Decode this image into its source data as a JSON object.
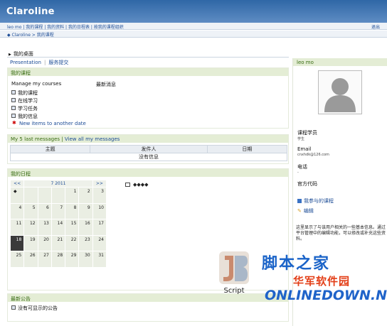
{
  "app": {
    "logo": "Claroline"
  },
  "topnav": {
    "links": "leo mo | 我的课程 | 我的资料 | 我的日程表 | 按我的课程组织",
    "right": "退出"
  },
  "breadcrumb": {
    "text": "◆ Claroline > 我的课程"
  },
  "page": {
    "title": "我的桌面"
  },
  "tabs": [
    {
      "label": "Presentation"
    },
    {
      "label": "服务提交"
    }
  ],
  "courses": {
    "heading": "我的课程",
    "manage": "Manage my courses",
    "recent_label": "最新消息",
    "items": [
      {
        "label": "我的课程"
      },
      {
        "label": "在线学习"
      },
      {
        "label": "学习任务"
      },
      {
        "label": "我的信息"
      }
    ],
    "new_items": "New items to another date"
  },
  "messages": {
    "heading_prefix": "My 5 last messages",
    "heading_link": "View all my messages",
    "columns": [
      "主题",
      "发件人",
      "日期"
    ],
    "empty": "没有信息"
  },
  "calendar": {
    "heading": "我的日程",
    "prev": "<<",
    "next": ">>",
    "month": "7 2011",
    "marker": "◆",
    "weeks": [
      [
        "",
        "",
        "",
        "1",
        "2",
        "3"
      ],
      [
        "4",
        "5",
        "6",
        "7",
        "8",
        "9",
        "10"
      ],
      [
        "11",
        "12",
        "13",
        "14",
        "15",
        "16",
        "17"
      ],
      [
        "18",
        "19",
        "20",
        "21",
        "22",
        "23",
        "24"
      ],
      [
        "25",
        "26",
        "27",
        "28",
        "29",
        "30",
        "31"
      ]
    ],
    "today": "18",
    "event": "◆◆◆◆"
  },
  "announcements": {
    "heading": "最新公告",
    "item": "没有可显示的公告"
  },
  "profile": {
    "name": "leo mo",
    "role_label": "课程学员",
    "role_value": "学生",
    "email_label": "Email",
    "email_value": "cnxhdk@126.com",
    "phone_label": "电话",
    "phone_value": "-",
    "admin_code_label": "官方代码",
    "link_manage": "我参与的课程",
    "link_edit": "编辑",
    "description": "这里显示了与该用户相关的一些基本信息。通过平台管理中的编辑功能，可以修改或补充这些资料。"
  },
  "watermarks": {
    "jb_script": "Script",
    "jiaoben": "脚本之家",
    "hjrj": "华军软件园",
    "onlinedown": "ONLINEDOWN.NET"
  },
  "colors": {
    "banner": "#2f67a6",
    "section_header_bg": "#e4edd5",
    "section_header_text": "#386c12",
    "link": "#1c4c96"
  }
}
